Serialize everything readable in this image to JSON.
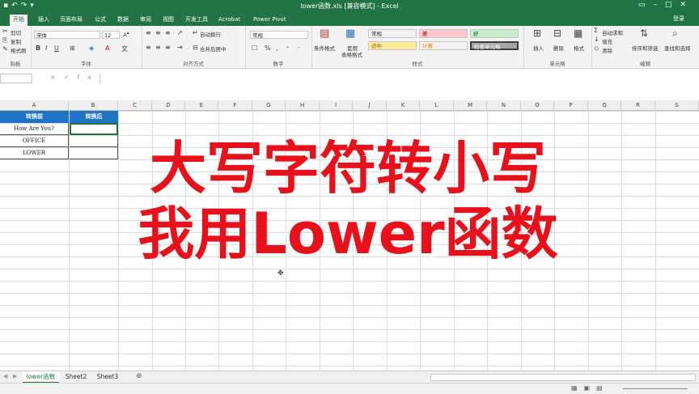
{
  "window": {
    "title": "lower函数.xls [兼容模式] - Excel",
    "signin": "登录",
    "qat_icons": [
      "save-icon",
      "undo-icon",
      "redo-icon",
      "customize-icon"
    ]
  },
  "tabs": [
    "开始",
    "插入",
    "页面布局",
    "公式",
    "数据",
    "审阅",
    "视图",
    "开发工具",
    "Acrobat",
    "Power Pivot"
  ],
  "active_tab": "开始",
  "ribbon": {
    "clipboard": {
      "cut": "剪切",
      "copy": "复制",
      "format_painter": "格式刷",
      "label": "贴板"
    },
    "font": {
      "name": "宋体",
      "size": "12",
      "label": "字体"
    },
    "alignment": {
      "wrap": "自动换行",
      "merge": "合并后居中",
      "label": "对齐方式"
    },
    "number": {
      "format": "常规",
      "label": "数字"
    },
    "styles": {
      "conditional": "条件格式",
      "table": "套用",
      "table2": "表格格式",
      "label": "样式",
      "cells": [
        {
          "text": "常规",
          "color": "#ffffff"
        },
        {
          "text": "差",
          "color": "#ffc7ce"
        },
        {
          "text": "好",
          "color": "#c6efce"
        },
        {
          "text": "适中",
          "color": "#ffeb9c"
        },
        {
          "text": "计算",
          "color": "#f2f2f2"
        },
        {
          "text": "检查单元格",
          "color": "#a5a5a5"
        }
      ]
    },
    "cells": {
      "insert": "插入",
      "delete": "删除",
      "format": "格式",
      "label": "单元格"
    },
    "editing": {
      "autosum": "自动求和",
      "fill": "填充",
      "clear": "清除",
      "sort": "排序和筛选",
      "find": "查找和选择",
      "label": "编辑"
    }
  },
  "formula_bar": {
    "cancel": "×",
    "enter": "✓",
    "fx": "fx"
  },
  "columns": [
    "A",
    "B",
    "C",
    "D",
    "E",
    "F",
    "G",
    "H",
    "I",
    "J",
    "K",
    "L",
    "M",
    "N",
    "O",
    "P",
    "Q",
    "R",
    "S"
  ],
  "sheet": {
    "headers": [
      "转换前",
      "转换后"
    ],
    "rows": [
      "How Are You?",
      "OFFICE",
      "LOWER"
    ]
  },
  "overlay": {
    "line1": "大写字符转小写",
    "line2": "我用Lower函数",
    "color": "#e8101a"
  },
  "sheets": [
    "lower函数",
    "Sheet2",
    "Sheet3"
  ],
  "active_sheet": "lower函数",
  "accent_color": "#217346"
}
